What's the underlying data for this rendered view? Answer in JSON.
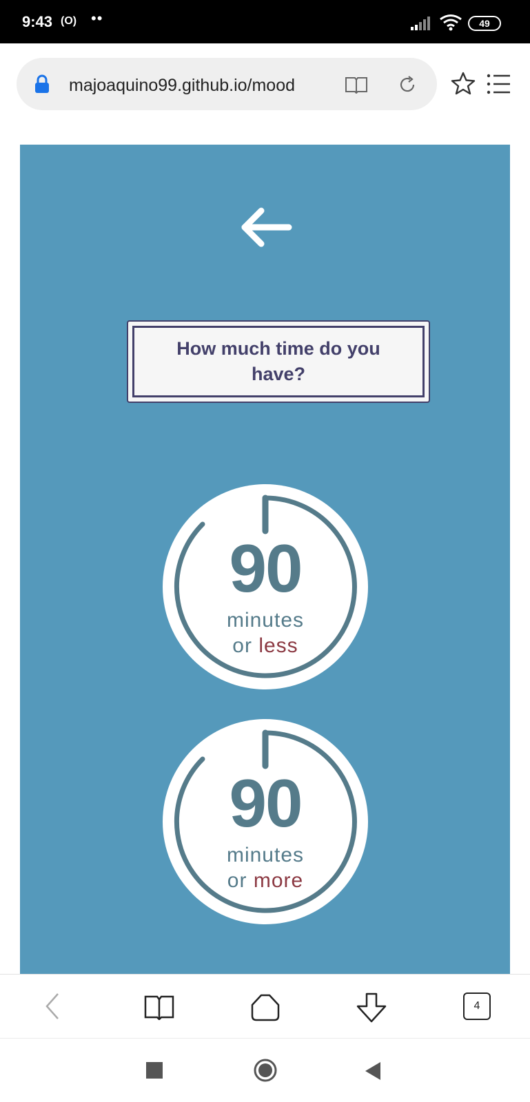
{
  "status_bar": {
    "time": "9:43",
    "extra": "(O)",
    "dots": "••",
    "battery": "49"
  },
  "address_bar": {
    "url": "majoaquino99.github.io/mood"
  },
  "page": {
    "background_color": "#5599bb",
    "question": "How much time do you have?",
    "options": [
      {
        "number": "90",
        "unit": "minutes",
        "prefix": "or",
        "qualifier": "less"
      },
      {
        "number": "90",
        "unit": "minutes",
        "prefix": "or",
        "qualifier": "more"
      }
    ]
  },
  "toolbar": {
    "tab_count": "4"
  },
  "icons": {
    "lock": "lock-icon",
    "reader": "reader-mode-icon",
    "reload": "reload-icon",
    "star": "star-icon",
    "menu": "menu-list-icon",
    "back_arrow": "arrow-left-icon",
    "nav_back": "chevron-left-icon",
    "bookmarks": "book-icon",
    "home": "home-icon",
    "download": "download-icon",
    "recents": "square-icon",
    "home_button": "circle-icon",
    "system_back": "triangle-back-icon"
  }
}
